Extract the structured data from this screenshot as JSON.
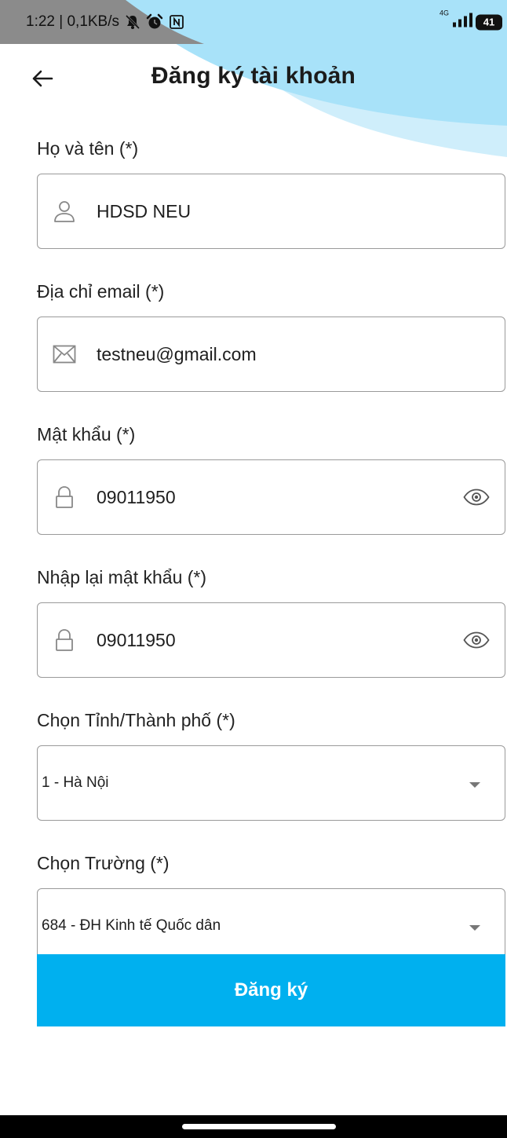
{
  "status_bar": {
    "time_speed": "1:22 | 0,1KB/s",
    "network_type": "4G",
    "battery": "41",
    "icons": [
      "muted-bell-icon",
      "alarm-icon",
      "nfc-icon",
      "signal-icon",
      "battery-icon"
    ]
  },
  "header": {
    "title": "Đăng ký tài khoản",
    "back_icon": "arrow-left-icon"
  },
  "form": {
    "full_name": {
      "label": "Họ và tên (*)",
      "value": "HDSD NEU",
      "icon": "person-icon"
    },
    "email": {
      "label": "Địa chỉ email (*)",
      "value": "testneu@gmail.com",
      "icon": "envelope-icon"
    },
    "password": {
      "label": "Mật khẩu (*)",
      "value": "09011950",
      "icon": "lock-icon",
      "toggle_icon": "eye-icon"
    },
    "confirm_password": {
      "label": "Nhập lại mật khẩu (*)",
      "value": "09011950",
      "icon": "lock-icon",
      "toggle_icon": "eye-icon"
    },
    "province": {
      "label": "Chọn Tỉnh/Thành phố (*)",
      "value": "1 - Hà Nội"
    },
    "school": {
      "label": "Chọn Trường (*)",
      "value": "684 - ĐH Kinh tế Quốc dân"
    }
  },
  "submit": {
    "label": "Đăng ký"
  },
  "colors": {
    "accent": "#00b0ef",
    "decor_light_blue": "#cfeefb",
    "decor_blue": "#a8e2f9",
    "border": "#9a9a9a"
  }
}
